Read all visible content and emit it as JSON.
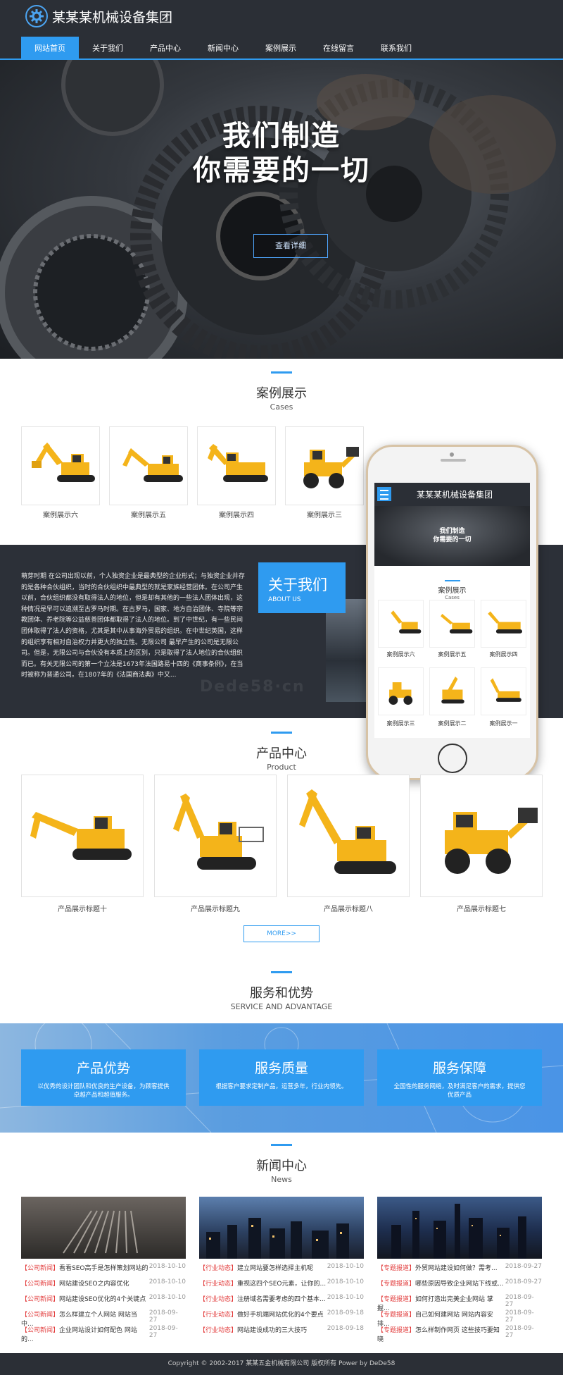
{
  "site": {
    "title": "某某某机械设备集团"
  },
  "nav": {
    "items": [
      "网站首页",
      "关于我们",
      "产品中心",
      "新闻中心",
      "案例展示",
      "在线留言",
      "联系我们"
    ]
  },
  "banner": {
    "line1": "我们制造",
    "line2": "你需要的一切",
    "button": "查看详细"
  },
  "cases": {
    "title": "案例展示",
    "en": "Cases",
    "items": [
      "案例展示六",
      "案例展示五",
      "案例展示四",
      "案例展示三"
    ]
  },
  "about": {
    "title": "关于我们",
    "en": "ABOUT US",
    "text": "萌芽时期 在公司出现以前，个人独资企业是最典型的企业形式；与独资企业并存的是各种合伙组织，当时的合伙组织中最典型的就是家族经营团体。在公司产生以前，合伙组织都没有取得法人的地位，但是却有其他的一些法人团体出现，这种情况是早可以追溯至古罗马时期。在古罗马，国家、地方自治团体、寺院等宗教团体、养老院等公益慈善团体都取得了法人的地位。到了中世纪，有一些民间团体取得了法人的资格，尤其是其中从事海外贸易的组织。在中世纪英国，这样的组织享有相对自治权力并更大的独立性。无限公司 最早产生的公司是无限公司。但是，无限公司与合伙没有本质上的区别，只是取得了法人地位的合伙组织而已。有关无限公司的第一个立法是1673年法国路易十四的《商事条例》，在当时被称为普通公司。在1807年的《法国商法典》中又..."
  },
  "watermark": "Dede58·cn",
  "phone": {
    "title": "某某某机械设备集团",
    "banner_line1": "我们制造",
    "banner_line2": "你需要的一切",
    "sec_title": "案例展示",
    "sec_en": "Cases",
    "items": [
      "案例展示六",
      "案例展示五",
      "案例展示四",
      "案例展示三",
      "案例展示二",
      "案例展示一"
    ]
  },
  "products": {
    "title": "产品中心",
    "en": "Product",
    "items": [
      "产品展示标题十",
      "产品展示标题九",
      "产品展示标题八",
      "产品展示标题七"
    ],
    "more": "MORE>>"
  },
  "service": {
    "title": "服务和优势",
    "en": "SERVICE AND ADVANTAGE",
    "cards": [
      {
        "title": "产品优势",
        "desc": "以优秀的设计团队和优良的生产设备，为顾客提供卓越产品和超值服务。"
      },
      {
        "title": "服务质量",
        "desc": "根据客户要求定制产品，运营多年，行业内领先。"
      },
      {
        "title": "服务保障",
        "desc": "全国性的服务网络，及时满足客户的需求，提供您优质产品"
      }
    ]
  },
  "news": {
    "title": "新闻中心",
    "en": "News",
    "columns": [
      [
        {
          "tag": "【公司新闻】",
          "title": "看看SEO高手是怎样策划网站的",
          "date": "2018-10-10"
        },
        {
          "tag": "【公司新闻】",
          "title": "网站建设SEO之内容优化",
          "date": "2018-10-10"
        },
        {
          "tag": "【公司新闻】",
          "title": "网站建设SEO优化的4个关键点",
          "date": "2018-10-10"
        },
        {
          "tag": "【公司新闻】",
          "title": "怎么样建立个人网站 网站当中...",
          "date": "2018-09-27"
        },
        {
          "tag": "【公司新闻】",
          "title": "企业网站设计如何配色 网站的...",
          "date": "2018-09-27"
        }
      ],
      [
        {
          "tag": "【行业动态】",
          "title": "建立网站要怎样选择主机呢",
          "date": "2018-10-10"
        },
        {
          "tag": "【行业动态】",
          "title": "重视这四个SEO元素，让你的...",
          "date": "2018-10-10"
        },
        {
          "tag": "【行业动态】",
          "title": "注册域名需要考虑的四个基本...",
          "date": "2018-10-10"
        },
        {
          "tag": "【行业动态】",
          "title": "做好手机端网站优化的4个要点",
          "date": "2018-09-18"
        },
        {
          "tag": "【行业动态】",
          "title": "网站建设成功的三大技巧",
          "date": "2018-09-18"
        }
      ],
      [
        {
          "tag": "【专题报道】",
          "title": "外贸网站建设如何做？需考...",
          "date": "2018-09-27"
        },
        {
          "tag": "【专题报道】",
          "title": "哪些原因导致企业网站下线或...",
          "date": "2018-09-27"
        },
        {
          "tag": "【专题报道】",
          "title": "如何打造出完美企业网站 掌握...",
          "date": "2018-09-27"
        },
        {
          "tag": "【专题报道】",
          "title": "自己如何建网站 网站内容安排...",
          "date": "2018-09-27"
        },
        {
          "tag": "【专题报道】",
          "title": "怎么样制作网页 这些技巧要知晓",
          "date": "2018-09-27"
        }
      ]
    ]
  },
  "footer": {
    "text": "Copyright © 2002-2017 某某五金机械有限公司 版权所有 Power by DeDe58"
  },
  "colors": {
    "accent": "#2f9bf0",
    "dark": "#2b2f36",
    "tag_red": "#e23b3b"
  }
}
